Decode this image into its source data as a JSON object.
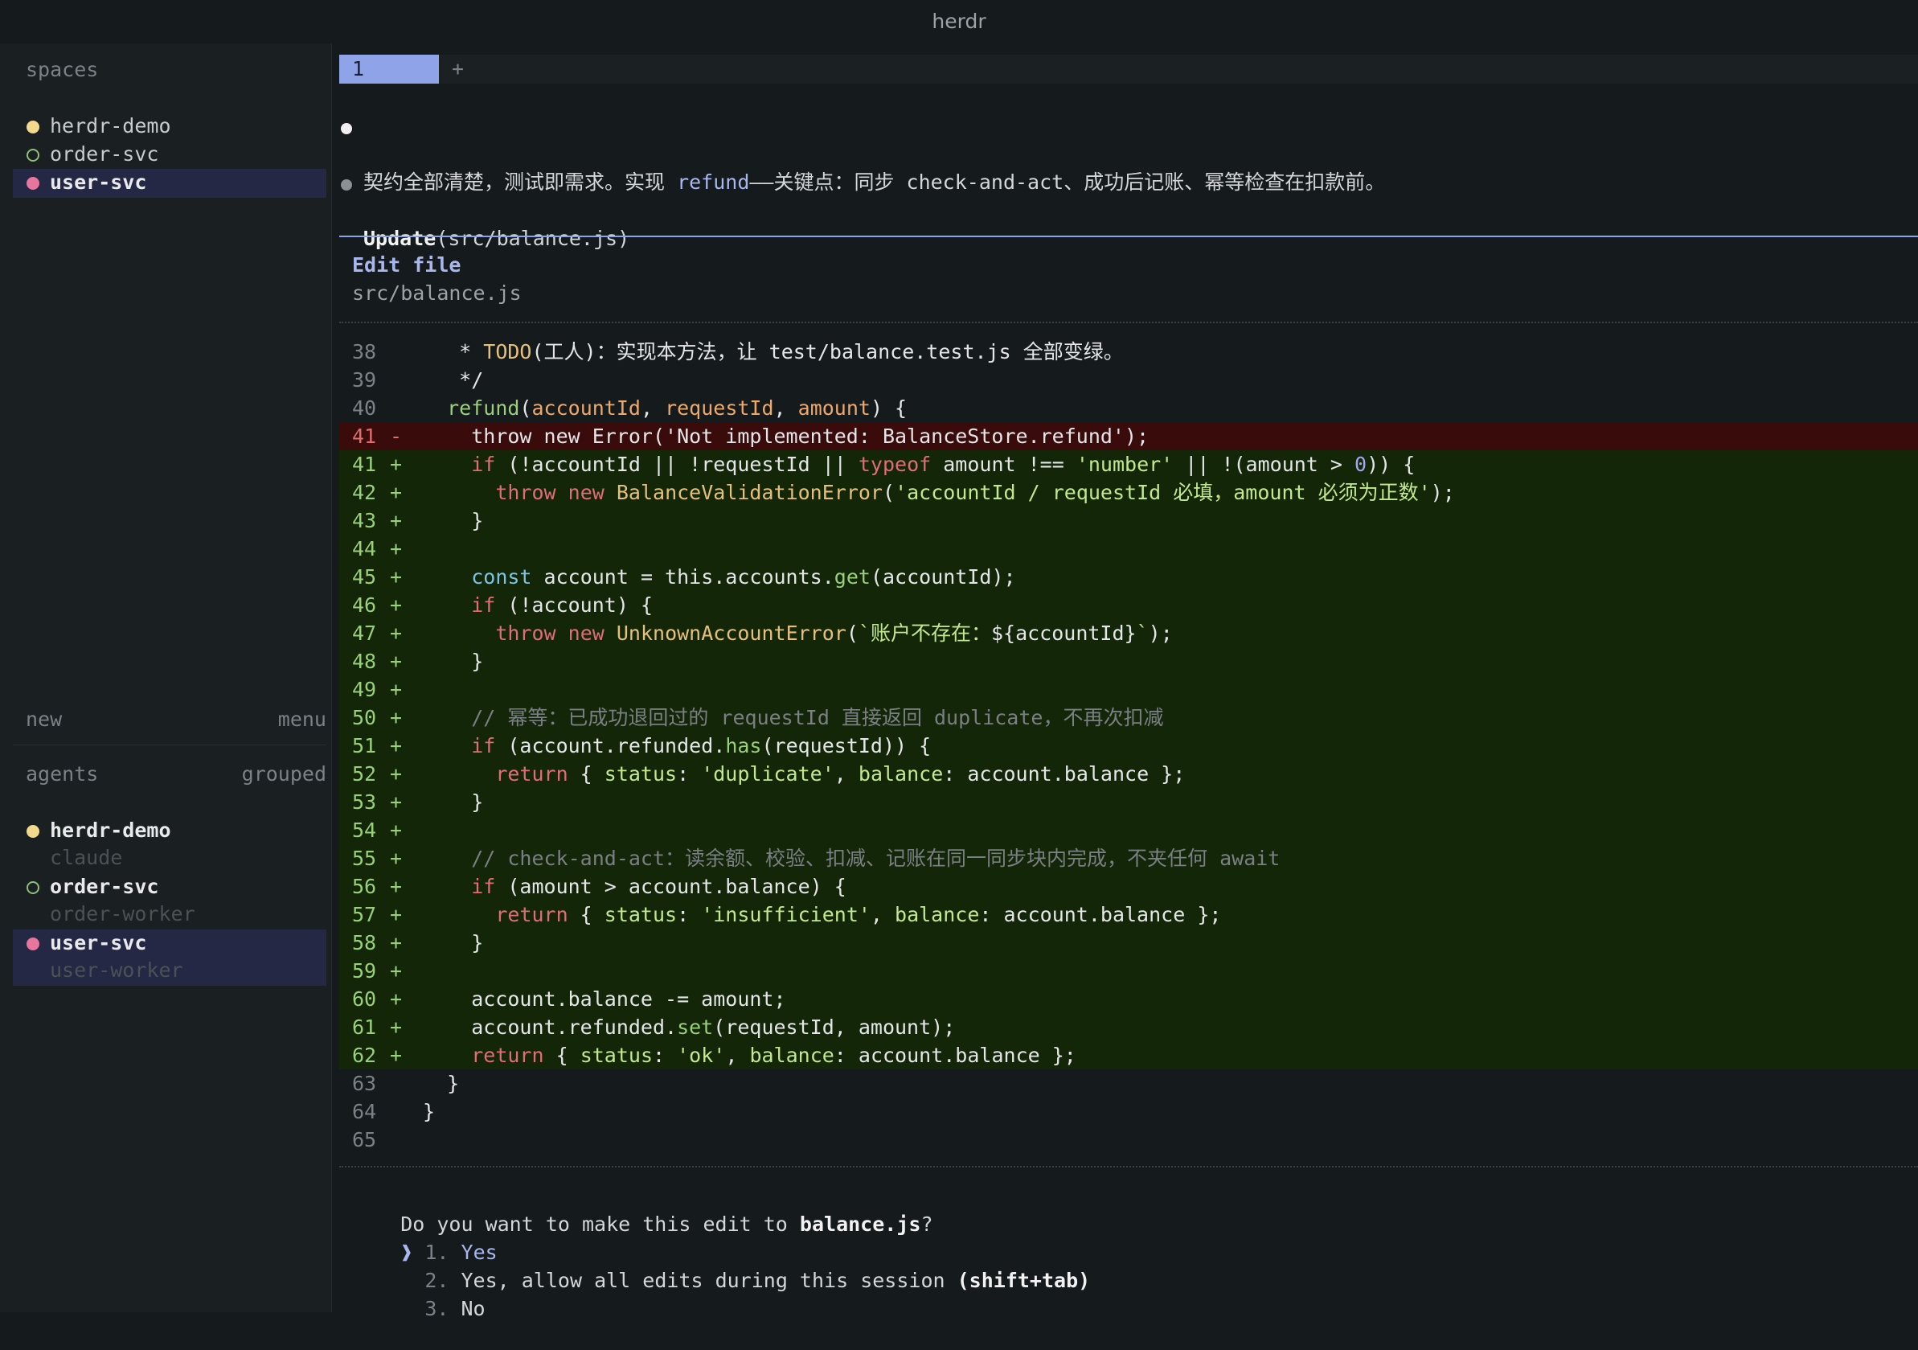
{
  "window": {
    "title": "herdr"
  },
  "sidebar": {
    "spaces_label": "spaces",
    "spaces": [
      {
        "label": "herdr-demo",
        "status": "active"
      },
      {
        "label": "order-svc",
        "status": "idle"
      },
      {
        "label": "user-svc",
        "status": "attention"
      }
    ],
    "new_label": "new",
    "menu_label": "menu",
    "agents_label": "agents",
    "grouped_label": "grouped",
    "agents": [
      {
        "space": "herdr-demo",
        "agent": "claude"
      },
      {
        "space": "order-svc",
        "agent": "order-worker"
      },
      {
        "space": "user-svc",
        "agent": "user-worker"
      }
    ]
  },
  "tabs": {
    "active": "1",
    "add": "+"
  },
  "chat": {
    "message": "契约全部清楚，测试即需求。实现 refund——关键点：同步 check-and-act、成功后记账、幂等检查在扣款前。",
    "message_pre": "契约全部清楚，测试即需求。实现 ",
    "message_code": "refund",
    "message_post": "——关键点：同步 check-and-act、成功后记账、幂等检查在扣款前。",
    "tool_name": "Update",
    "tool_arg": "(src/balance.js)"
  },
  "edit": {
    "title": "Edit file",
    "path": "src/balance.js"
  },
  "prompt": {
    "question_pre": "Do you want to make this edit to ",
    "question_file": "balance.js",
    "question_post": "?",
    "cursor": "❱",
    "options": [
      {
        "num": "1.",
        "label": "Yes",
        "hint": ""
      },
      {
        "num": "2.",
        "label": "Yes, allow all edits during this session ",
        "hint": "(shift+tab)"
      },
      {
        "num": "3.",
        "label": "No",
        "hint": ""
      }
    ]
  },
  "colors": {
    "accent": "#8fa3e8",
    "deleted_bg": "#3a0b0b",
    "added_bg": "#132708",
    "status_active": "#f2d98c",
    "status_idle": "#8fbf7a",
    "status_attention": "#e8759c"
  }
}
